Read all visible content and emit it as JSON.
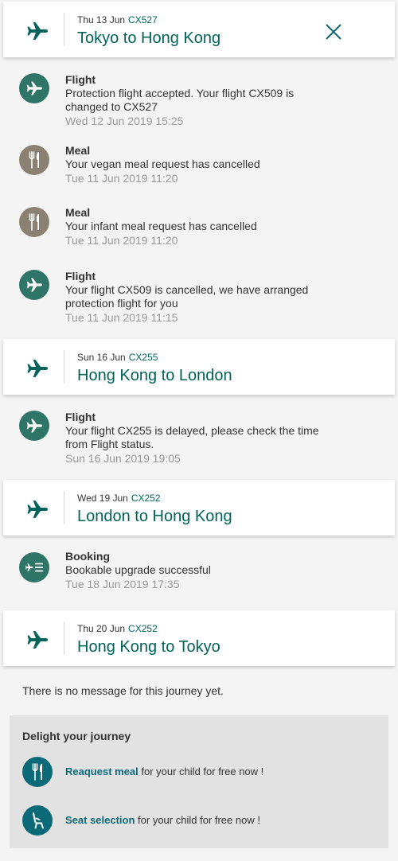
{
  "colors": {
    "accent": "#00645a",
    "flight_green": "#2f7567",
    "meal_brown": "#8b8172",
    "teal": "#0b6a78"
  },
  "journeys": [
    {
      "date": "Thu 13 Jun",
      "code": "CX527",
      "route": "Tokyo to Hong Kong",
      "icon": "plane-icon"
    },
    {
      "date": "Sun 16 Jun",
      "code": "CX255",
      "route": "Hong Kong to London",
      "icon": "plane-icon"
    },
    {
      "date": "Wed 19 Jun",
      "code": "CX252",
      "route": "London to Hong Kong",
      "icon": "plane-icon"
    },
    {
      "date": "Thu 20 Jun",
      "code": "CX252",
      "route": "Hong Kong to Tokyo",
      "icon": "plane-icon"
    }
  ],
  "close_icon": "close-icon",
  "messages": [
    {
      "type": "Flight",
      "icon": "plane-icon",
      "body": "Protection flight accepted. Your flight CX509 is changed to CX527",
      "date": "Wed 12 Jun 2019 15:25"
    },
    {
      "type": "Meal",
      "icon": "fork-knife-icon",
      "body": "Your vegan meal request has cancelled",
      "date": "Tue 11 Jun 2019 11:20"
    },
    {
      "type": "Meal",
      "icon": "fork-knife-icon",
      "body": "Your infant meal request has cancelled",
      "date": "Tue 11 Jun 2019 11:20"
    },
    {
      "type": "Flight",
      "icon": "plane-icon",
      "body": "Your flight CX509 is cancelled, we have arranged protection flight for you",
      "date": "Tue 11 Jun 2019 11:15"
    },
    {
      "type": "Flight",
      "icon": "plane-icon",
      "body": "Your flight CX255 is delayed, please check the time from Flight status.",
      "date": "Sun 16 Jun 2019 19:05"
    },
    {
      "type": "Booking",
      "icon": "upgrade-icon",
      "body": "Bookable upgrade successful",
      "date": "Tue 18 Jun 2019 17:35"
    }
  ],
  "no_message": "There is no message for this journey yet.",
  "delight": {
    "title": "Delight your journey",
    "items": [
      {
        "link": "Reaquest meal",
        "rest": " for your child for free now !",
        "icon": "fork-knife-icon"
      },
      {
        "link": "Seat selection",
        "rest": " for your child for free now !",
        "icon": "seat-icon"
      }
    ]
  }
}
